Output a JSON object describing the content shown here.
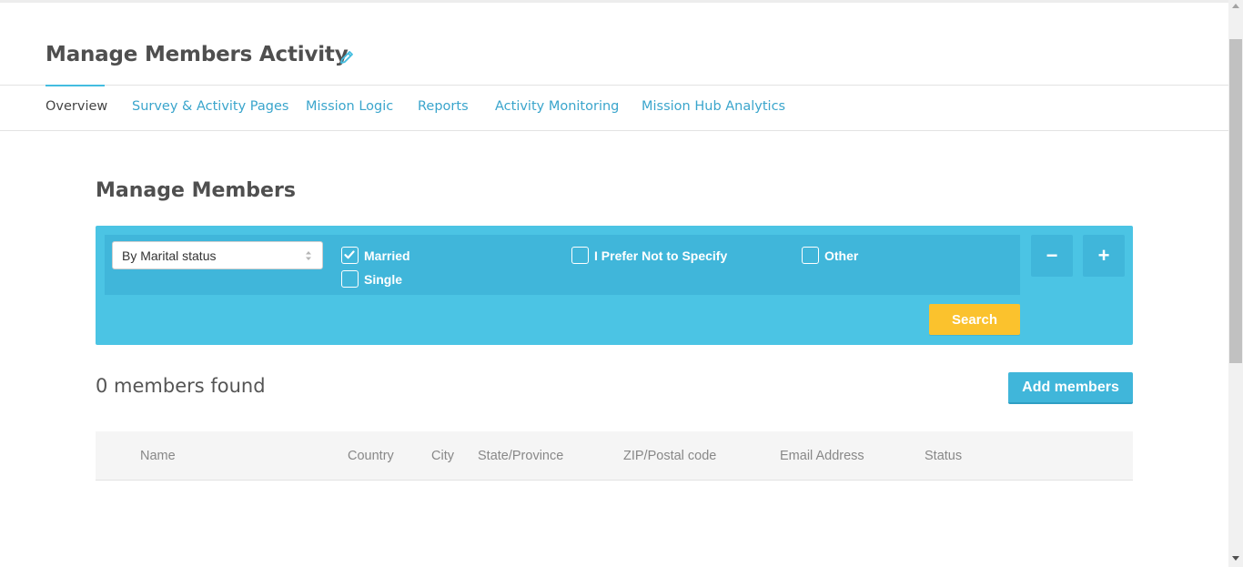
{
  "header": {
    "title": "Manage Members Activity",
    "edit_icon": "pencil-icon"
  },
  "tabs": [
    {
      "label": "Overview",
      "active": true
    },
    {
      "label": "Survey & Activity Pages",
      "active": false
    },
    {
      "label": "Mission Logic",
      "active": false
    },
    {
      "label": "Reports",
      "active": false
    },
    {
      "label": "Activity Monitoring",
      "active": false
    },
    {
      "label": "Mission Hub Analytics",
      "active": false
    }
  ],
  "section": {
    "title": "Manage Members"
  },
  "filter": {
    "select_value": "By Marital status",
    "options": [
      {
        "label": "Married",
        "checked": true
      },
      {
        "label": "Single",
        "checked": false
      },
      {
        "label": "I Prefer Not to Specify",
        "checked": false
      },
      {
        "label": "Other",
        "checked": false
      }
    ],
    "remove_label": "−",
    "add_label": "+",
    "search_label": "Search"
  },
  "results": {
    "count_text": "0 members found",
    "add_members_label": "Add members"
  },
  "table": {
    "columns": [
      "Name",
      "Country",
      "City",
      "State/Province",
      "ZIP/Postal code",
      "Email Address",
      "Status"
    ]
  },
  "colors": {
    "accent": "#44bde0",
    "panel": "#4bc4e4",
    "panel_dark": "#40b6da",
    "search_button": "#fbc22d",
    "link": "#3aa5cc"
  }
}
